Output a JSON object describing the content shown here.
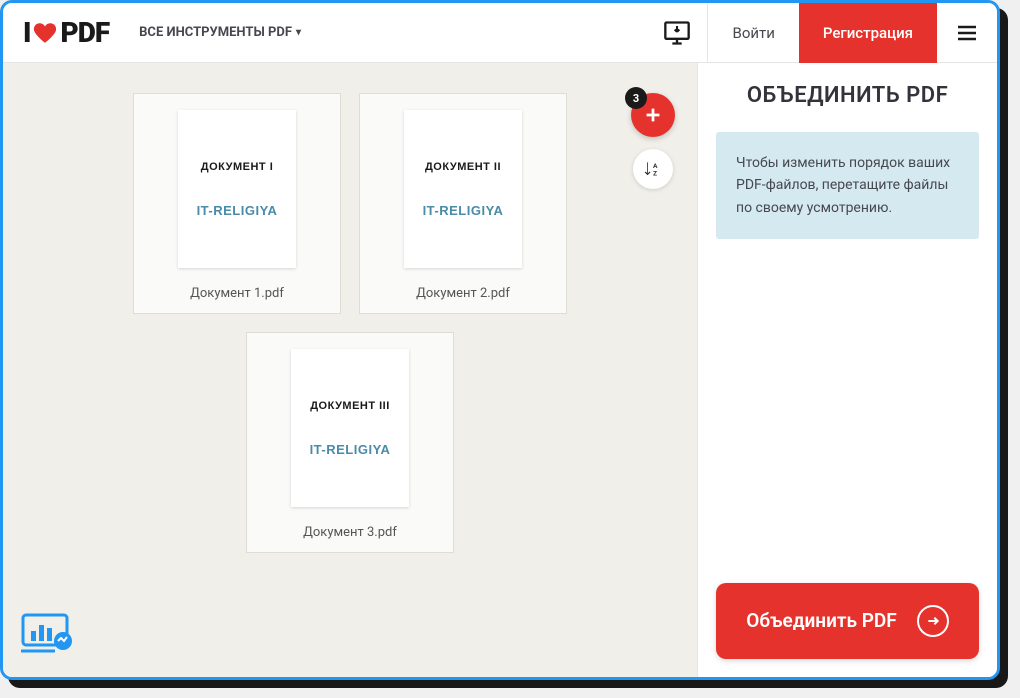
{
  "header": {
    "logo_prefix": "I",
    "logo_suffix": "PDF",
    "tools_label": "ВСЕ ИНСТРУМЕНТЫ PDF",
    "login_label": "Войти",
    "register_label": "Регистрация"
  },
  "workspace": {
    "file_count": "3",
    "files": [
      {
        "doc_title": "ДОКУМЕНТ I",
        "brand": "IT-RELIGIYA",
        "filename": "Документ 1.pdf"
      },
      {
        "doc_title": "ДОКУМЕНТ II",
        "brand": "IT-RELIGIYA",
        "filename": "Документ 2.pdf"
      },
      {
        "doc_title": "ДОКУМЕНТ III",
        "brand": "IT-RELIGIYA",
        "filename": "Документ 3.pdf"
      }
    ]
  },
  "sidebar": {
    "title": "ОБЪЕДИНИТЬ PDF",
    "info_text": "Чтобы изменить порядок ваших PDF-файлов, перетащите файлы по своему усмотрению.",
    "merge_label": "Объединить PDF"
  }
}
